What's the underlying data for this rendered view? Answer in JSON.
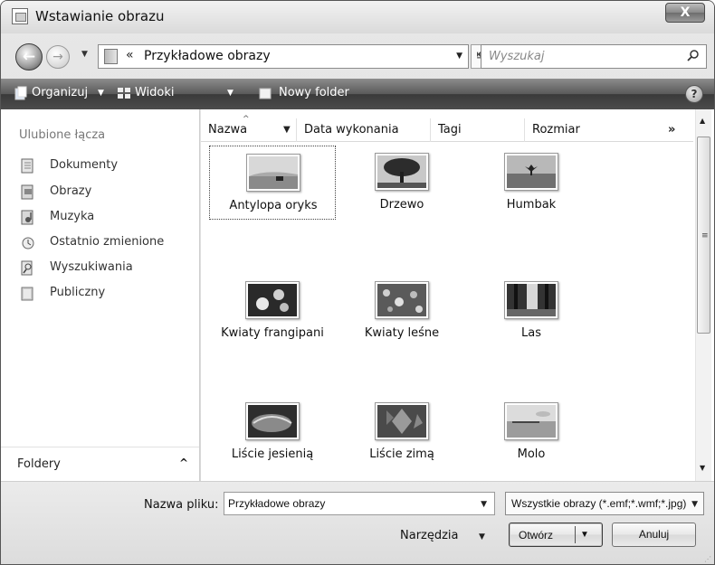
{
  "window": {
    "title": "Wstawianie obrazu",
    "close_label": "X"
  },
  "nav": {
    "back_glyph": "←",
    "forward_glyph": "→",
    "address_chevron": "«",
    "address": "Przykładowe obrazy",
    "search_placeholder": "Wyszukaj"
  },
  "toolbar": {
    "organize": "Organizuj",
    "views": "Widoki",
    "new_folder": "Nowy folder",
    "help": "?"
  },
  "sidebar": {
    "header": "Ulubione łącza",
    "items": [
      {
        "label": "Dokumenty",
        "icon": "documents-icon"
      },
      {
        "label": "Obrazy",
        "icon": "pictures-icon"
      },
      {
        "label": "Muzyka",
        "icon": "music-icon"
      },
      {
        "label": "Ostatnio zmienione",
        "icon": "recent-icon"
      },
      {
        "label": "Wyszukiwania",
        "icon": "searches-icon"
      },
      {
        "label": "Publiczny",
        "icon": "public-icon"
      }
    ],
    "folders_label": "Foldery"
  },
  "columns": [
    "Nazwa",
    "Data wykonania",
    "Tagi",
    "Rozmiar"
  ],
  "columns_more": "»",
  "files": [
    {
      "name": "Antylopa oryks",
      "selected": true
    },
    {
      "name": "Drzewo"
    },
    {
      "name": "Humbak"
    },
    {
      "name": "Kwiaty frangipani"
    },
    {
      "name": "Kwiaty leśne"
    },
    {
      "name": "Las"
    },
    {
      "name": "Liście jesienią"
    },
    {
      "name": "Liście zimą"
    },
    {
      "name": "Molo"
    }
  ],
  "bottom": {
    "filename_label": "Nazwa pliku:",
    "filename_value": "Przykładowe obrazy",
    "filter_value": "Wszystkie obrazy (*.emf;*.wmf;*.jpg)",
    "tools_label": "Narzędzia",
    "open_label": "Otwórz",
    "cancel_label": "Anuluj"
  }
}
